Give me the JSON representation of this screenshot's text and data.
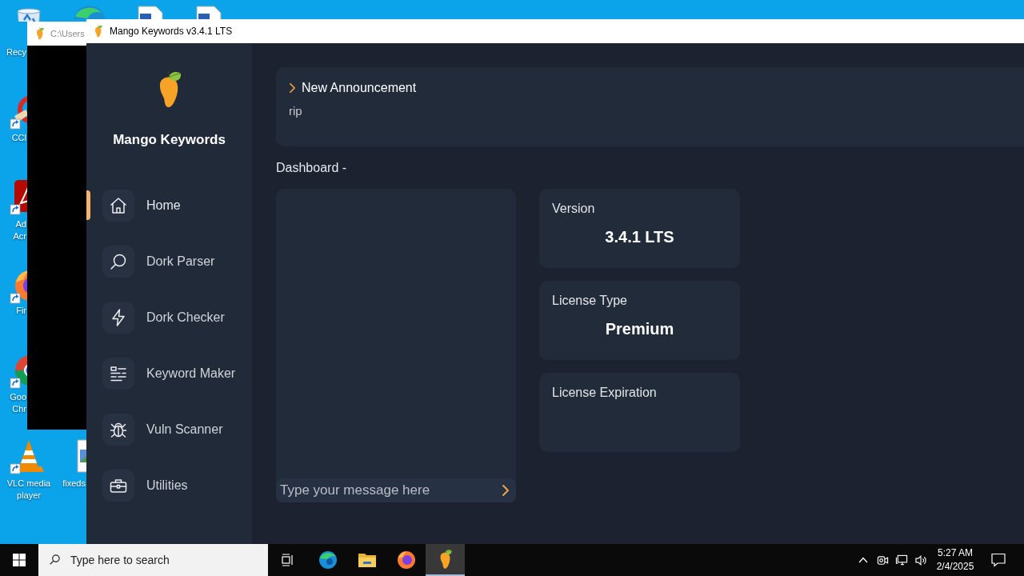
{
  "desktop": {
    "icons": [
      {
        "lines": [
          "Recy"
        ]
      },
      {
        "lines": [
          "CCl"
        ]
      },
      {
        "lines": [
          "Ad",
          "Acr"
        ]
      },
      {
        "lines": [
          "Fir"
        ]
      },
      {
        "lines": [
          "Goo",
          "Chr"
        ]
      },
      {
        "lines": [
          "VLC media",
          "player"
        ]
      },
      {
        "lines": [
          "fixeds"
        ]
      }
    ]
  },
  "console_window": {
    "title": "C:\\Users"
  },
  "window": {
    "title": "Mango Keywords v3.4.1 LTS"
  },
  "sidebar": {
    "brand": "Mango Keywords",
    "items": [
      {
        "label": "Home",
        "selected": true
      },
      {
        "label": "Dork Parser",
        "selected": false
      },
      {
        "label": "Dork Checker",
        "selected": false
      },
      {
        "label": "Keyword Maker",
        "selected": false
      },
      {
        "label": "Vuln Scanner",
        "selected": false
      },
      {
        "label": "Utilities",
        "selected": false
      }
    ]
  },
  "announcement": {
    "title": "New Announcement",
    "body": "rip"
  },
  "dashboard": {
    "heading": "Dashboard -",
    "chat": {
      "placeholder": "Type your message here"
    },
    "cards": [
      {
        "label": "Version",
        "value": "3.4.1 LTS"
      },
      {
        "label": "License Type",
        "value": "Premium"
      },
      {
        "label": "License Expiration"
      }
    ]
  },
  "taskbar": {
    "search": {
      "placeholder": "Type here to search"
    },
    "apps": [
      {
        "selected": false
      },
      {
        "selected": false
      },
      {
        "selected": false
      },
      {
        "selected": true
      }
    ],
    "clock": {
      "time": "5:27 AM",
      "date": "2/4/2025"
    }
  }
}
